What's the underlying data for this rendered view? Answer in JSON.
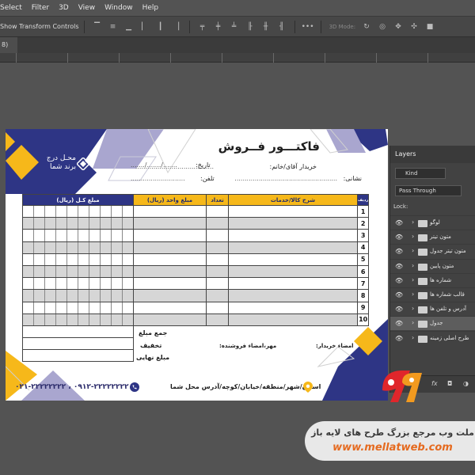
{
  "menu": [
    "Select",
    "Filter",
    "3D",
    "View",
    "Window",
    "Help"
  ],
  "options": {
    "transform_label": "Show Transform Controls",
    "mode_label": "3D Mode:"
  },
  "tab": {
    "label": "8)"
  },
  "ruler": [
    "",
    "",
    "",
    "",
    "",
    "",
    "",
    "",
    ""
  ],
  "invoice": {
    "title": "فاکتـــور فــروش",
    "buyer": "خریدار آقای/خانم:",
    "date": "تاریخ:",
    "date_slots": "......./......./.......",
    "address": "نشانی:",
    "phone": "تلفن:",
    "logo_line1": "محـل درج",
    "logo_line2": "برند شما",
    "headers": {
      "row": "ردیف",
      "desc": "شرح کالا/خدمات",
      "qty": "تعداد",
      "unit": "مبلغ واحد (ریال)",
      "total": "مبلغ کـل (ریال)"
    },
    "rows": [
      "1",
      "2",
      "3",
      "4",
      "5",
      "6",
      "7",
      "8",
      "9",
      "10"
    ],
    "sum": "جمع مبلغ",
    "discount": "تخفیف",
    "final": "مبلغ نهایی",
    "seller_sign": "مهر،امضاء فروشنده:",
    "buyer_sign": "امضاء خریدار:",
    "phones": "۰۲۱-۲۲۲۲۲۲۲۲ ، ۰۹۱۲-۲۲۲۲۲۲۲۲",
    "footer_address": "استان/شهر/منطقه/خیابان/کوچه/آدرس محل شما"
  },
  "layers": {
    "title": "Layers",
    "kind": "Kind",
    "blend": "Pass Through",
    "lock": "Lock:",
    "items": [
      {
        "name": "لوگو",
        "selected": false
      },
      {
        "name": "متون تیتر",
        "selected": false
      },
      {
        "name": "متون تیتر جدول",
        "selected": false
      },
      {
        "name": "متون پایین",
        "selected": false
      },
      {
        "name": "شماره ها",
        "selected": false
      },
      {
        "name": "قالب شماره ها",
        "selected": false
      },
      {
        "name": "آدرس و تلفن ها",
        "selected": false
      },
      {
        "name": "جدول",
        "selected": true
      },
      {
        "name": "طرح اصلی زمینه",
        "selected": false
      }
    ]
  },
  "watermark": {
    "line1": "ملت وب مرجع بزرگ طرح های لایه باز",
    "line2": "www.mellatweb.com"
  },
  "colors": {
    "navy": "#2e3585",
    "yellow": "#f6b81a",
    "lavender": "#a9a6cf"
  }
}
